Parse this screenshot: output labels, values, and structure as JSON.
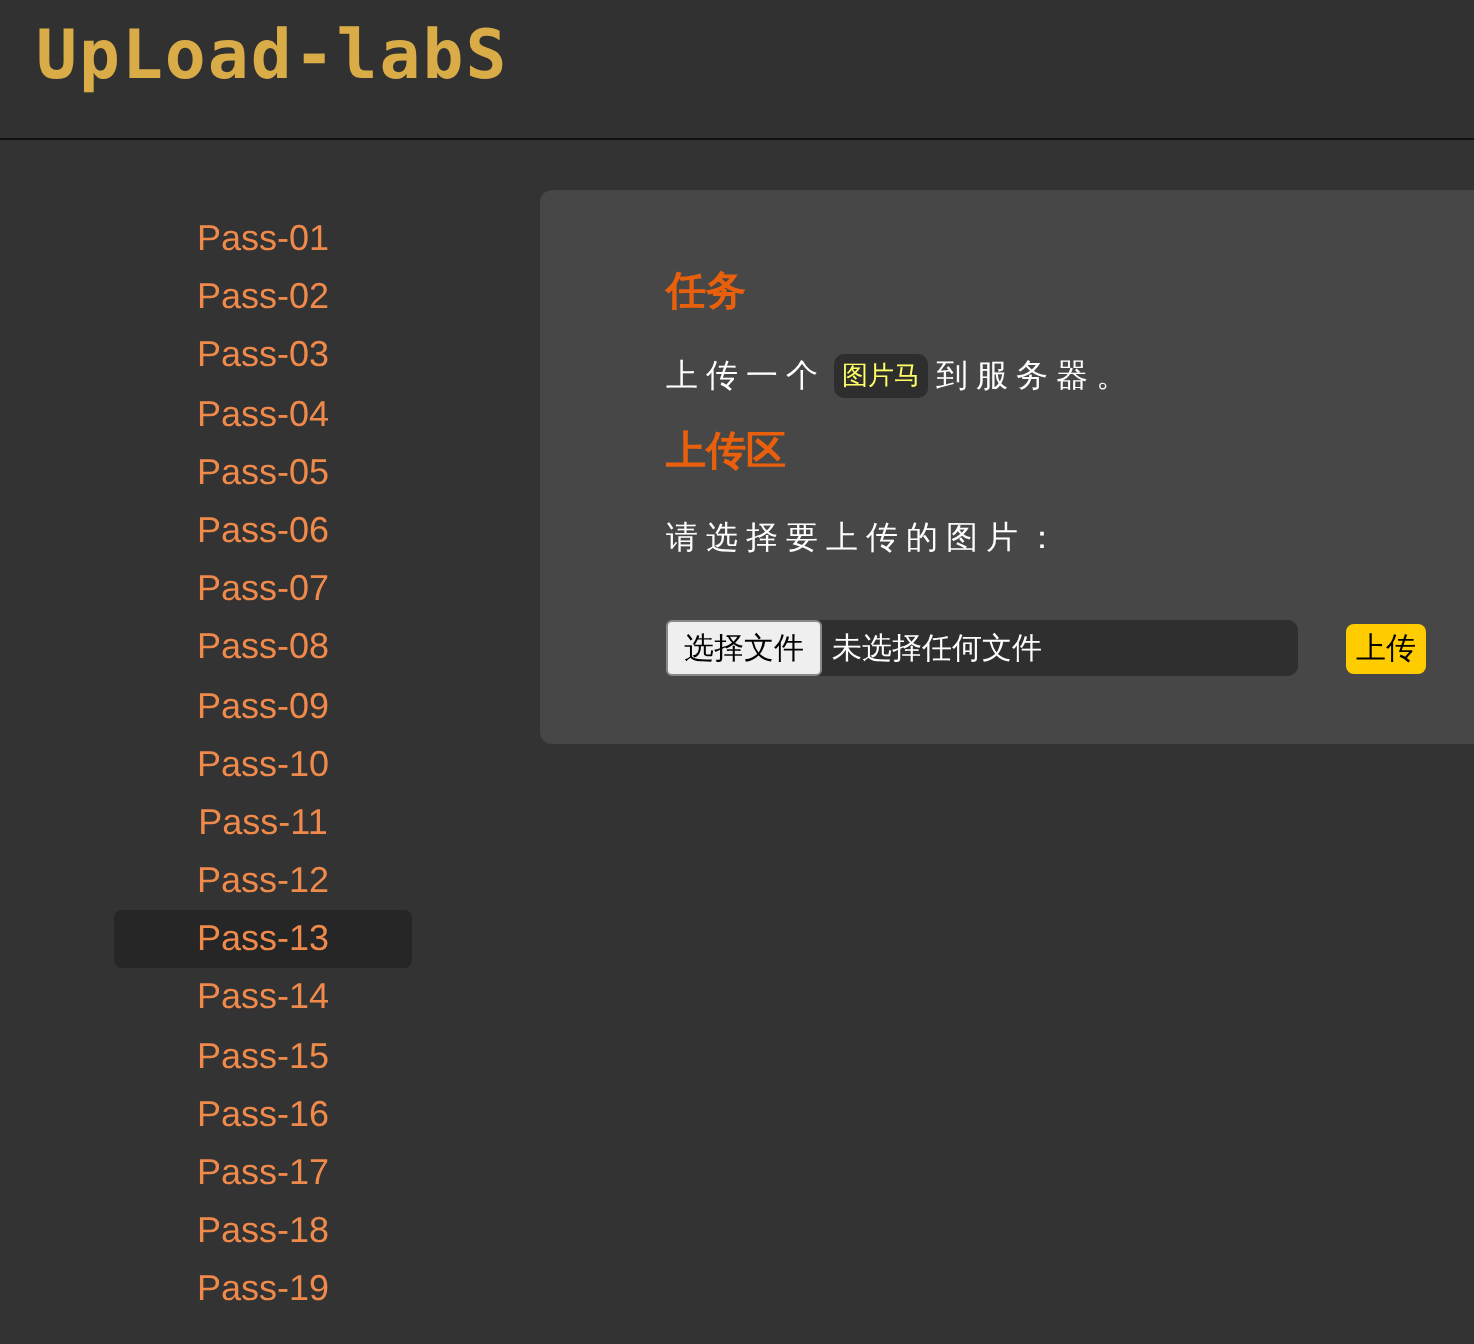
{
  "logo": "UpLoad-labS",
  "sidebar": {
    "items": [
      {
        "label": "Pass-01",
        "selected": false
      },
      {
        "label": "Pass-02",
        "selected": false
      },
      {
        "label": "Pass-03",
        "selected": false
      },
      {
        "label": "Pass-04",
        "selected": false
      },
      {
        "label": "Pass-05",
        "selected": false
      },
      {
        "label": "Pass-06",
        "selected": false
      },
      {
        "label": "Pass-07",
        "selected": false
      },
      {
        "label": "Pass-08",
        "selected": false
      },
      {
        "label": "Pass-09",
        "selected": false
      },
      {
        "label": "Pass-10",
        "selected": false
      },
      {
        "label": "Pass-11",
        "selected": false
      },
      {
        "label": "Pass-12",
        "selected": false
      },
      {
        "label": "Pass-13",
        "selected": true
      },
      {
        "label": "Pass-14",
        "selected": false
      },
      {
        "label": "Pass-15",
        "selected": false
      },
      {
        "label": "Pass-16",
        "selected": false
      },
      {
        "label": "Pass-17",
        "selected": false
      },
      {
        "label": "Pass-18",
        "selected": false
      },
      {
        "label": "Pass-19",
        "selected": false
      }
    ]
  },
  "task": {
    "heading": "任务",
    "text_before": "上传一个",
    "code": "图片马",
    "text_after": "到服务器。"
  },
  "upload": {
    "heading": "上传区",
    "prompt": "请选择要上传的图片：",
    "choose_button": "选择文件",
    "file_status": "未选择任何文件",
    "submit_button": "上传"
  }
}
